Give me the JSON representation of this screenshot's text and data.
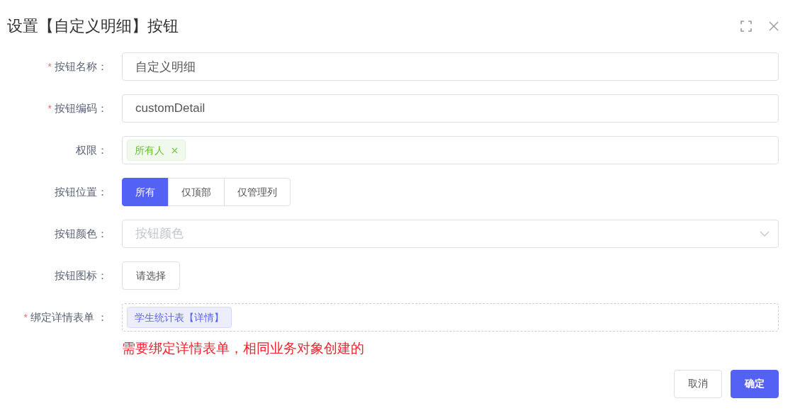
{
  "dialog": {
    "title": "设置【自定义明细】按钮"
  },
  "fields": [
    {
      "kind": "input",
      "label": "按钮名称：",
      "required_mark": "*",
      "value": "自定义明细"
    },
    {
      "kind": "input",
      "label": "按钮编码：",
      "required_mark": "*",
      "value": "customDetail"
    },
    {
      "kind": "tags",
      "label": "权限：",
      "tags": [
        "所有人"
      ]
    },
    {
      "kind": "segmented",
      "label": "按钮位置：",
      "options": [
        {
          "label": "所有",
          "selected": true
        },
        {
          "label": "仅顶部",
          "selected": false
        },
        {
          "label": "仅管理列",
          "selected": false
        }
      ]
    },
    {
      "kind": "select",
      "label": "按钮颜色：",
      "placeholder": "按钮颜色"
    },
    {
      "kind": "button",
      "label": "按钮图标：",
      "button": "请选择"
    },
    {
      "kind": "bind",
      "label": "绑定详情表单 ：",
      "required_mark": "*",
      "tags": [
        "学生统计表【详情】"
      ],
      "hint": "需要绑定详情表单，相同业务对象创建的"
    }
  ],
  "footer": {
    "cancel": "取消",
    "confirm": "确定"
  }
}
